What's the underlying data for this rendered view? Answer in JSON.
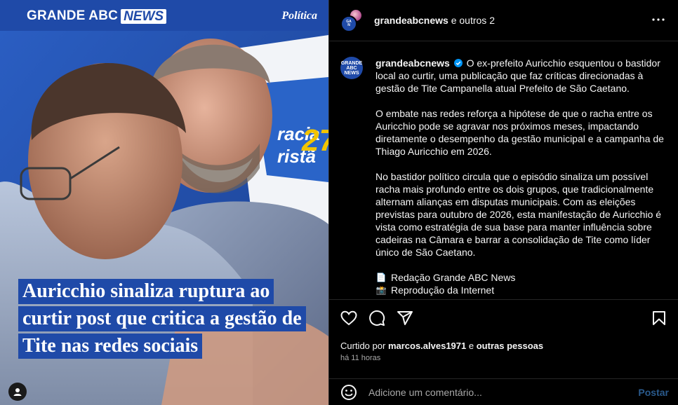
{
  "media": {
    "brand_text": "GRANDE ABC",
    "brand_news": "NEWS",
    "section": "Política",
    "headline_lines": [
      "Auricchio sinaliza ruptura ao",
      "curtir post que critica a gestão de",
      "Tite nas redes sociais"
    ],
    "bg_banner_text_1": "racia",
    "bg_banner_text_2": "ristã",
    "bg_banner_number": "27"
  },
  "header": {
    "names": "grandeabcnews",
    "others": "e outros 2"
  },
  "caption": {
    "username": "grandeabcnews",
    "paragraph1": "O ex-prefeito Auricchio esquentou o bastidor local ao curtir, uma publicação que faz críticas direcionadas à gestão de Tite Campanella atual Prefeito de São Caetano.",
    "paragraph2": "O embate nas redes reforça a hipótese de que o racha entre os Auricchio pode se agravar nos próximos meses, impactando diretamente o desempenho da gestão municipal e a campanha de Thiago Auricchio em 2026.",
    "paragraph3": "No bastidor político circula que o episódio sinaliza um possível racha mais profundo entre os dois grupos, que tradicionalmente alternam alianças em disputas municipais. Com as eleições previstas para outubro de 2026, esta manifestação de Auricchio é vista como estratégia de sua base para manter influência sobre cadeiras na Câmara e barrar a consolidação de Tite como líder único de São Caetano.",
    "signature1": "Redação Grande ABC News",
    "signature2": "Reprodução da Internet",
    "sig1_icon": "📄",
    "sig2_icon": "📸"
  },
  "likes": {
    "prefix": "Curtido por",
    "user": "marcos.alves1971",
    "joiner": "e",
    "others": "outras pessoas"
  },
  "timestamp": "há 11 horas",
  "comment": {
    "placeholder": "Adicione um comentário...",
    "post_label": "Postar"
  },
  "colors": {
    "brand_blue": "#1f4aa8",
    "verified": "#0095f6",
    "muted": "#a8a8a8"
  },
  "icons": [
    "heart-icon",
    "comment-icon",
    "share-icon",
    "bookmark-icon",
    "more-icon",
    "emoji-icon",
    "verified-icon",
    "user-tag-icon"
  ]
}
